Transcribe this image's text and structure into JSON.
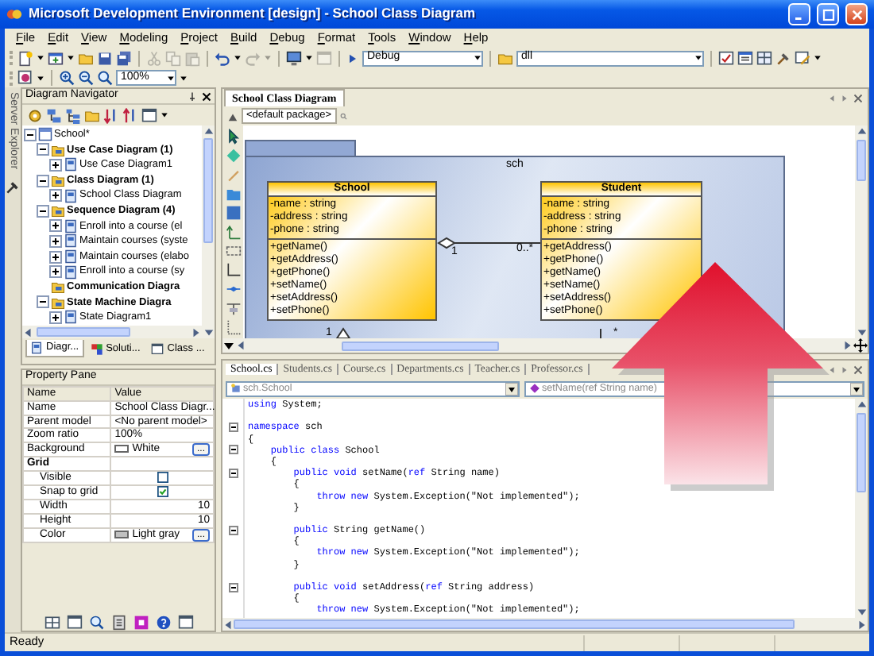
{
  "window": {
    "title": "Microsoft Development Environment [design] - School Class Diagram"
  },
  "menu": [
    "File",
    "Edit",
    "View",
    "Modeling",
    "Project",
    "Build",
    "Debug",
    "Format",
    "Tools",
    "Window",
    "Help"
  ],
  "toolbar": {
    "groups": [
      [
        {
          "kind": "new-project",
          "disabled": false,
          "has_menu": true
        },
        {
          "kind": "add-item",
          "disabled": false,
          "has_menu": true
        },
        {
          "kind": "open",
          "disabled": false,
          "has_menu": false
        },
        {
          "kind": "save",
          "disabled": false,
          "has_menu": false
        },
        {
          "kind": "save-all",
          "disabled": false,
          "has_menu": false
        }
      ],
      [
        {
          "kind": "cut",
          "disabled": true,
          "has_menu": false
        },
        {
          "kind": "copy",
          "disabled": true,
          "has_menu": false
        },
        {
          "kind": "paste",
          "disabled": true,
          "has_menu": false
        }
      ],
      [
        {
          "kind": "undo",
          "disabled": false,
          "has_menu": true
        },
        {
          "kind": "redo",
          "disabled": true,
          "has_menu": true
        }
      ],
      [
        {
          "kind": "navigate",
          "disabled": false,
          "has_menu": true
        },
        {
          "kind": "browse",
          "disabled": true,
          "has_menu": false
        }
      ]
    ],
    "configuration": "Debug",
    "project": "dll",
    "zoom": "100%"
  },
  "side_strip": {
    "label": "Server Explorer"
  },
  "diagram_navigator": {
    "title": "Diagram Navigator",
    "tree": [
      {
        "label": "School*",
        "kind": "model",
        "expanded": true,
        "children": [
          {
            "label": "Use Case Diagram (1)",
            "kind": "folder",
            "expanded": true,
            "children": [
              {
                "label": "Use Case Diagram1",
                "kind": "diagram",
                "expanded": false
              }
            ]
          },
          {
            "label": "Class Diagram (1)",
            "kind": "folder",
            "expanded": true,
            "children": [
              {
                "label": "School Class Diagram",
                "kind": "diagram",
                "expanded": false
              }
            ]
          },
          {
            "label": "Sequence Diagram (4)",
            "kind": "folder",
            "expanded": true,
            "children": [
              {
                "label": "Enroll into a course (el",
                "kind": "diagram",
                "expanded": false
              },
              {
                "label": "Maintain courses (syste",
                "kind": "diagram",
                "expanded": false
              },
              {
                "label": "Maintain courses (elabo",
                "kind": "diagram",
                "expanded": false
              },
              {
                "label": "Enroll into a course (sy",
                "kind": "diagram",
                "expanded": false
              }
            ]
          },
          {
            "label": "Communication Diagra",
            "kind": "folder"
          },
          {
            "label": "State Machine Diagra",
            "kind": "folder",
            "expanded": true,
            "children": [
              {
                "label": "State Diagram1",
                "kind": "diagram",
                "expanded": false
              }
            ]
          }
        ]
      }
    ],
    "tabs": [
      {
        "label": "Diagr...",
        "selected": true
      },
      {
        "label": "Soluti...",
        "selected": false
      },
      {
        "label": "Class ...",
        "selected": false
      }
    ]
  },
  "property_pane": {
    "title": "Property Pane",
    "columns": [
      "Name",
      "Value"
    ],
    "rows": [
      {
        "kind": "text",
        "name": "Name",
        "value": "School Class Diagr..."
      },
      {
        "kind": "text",
        "name": "Parent model",
        "value": "<No parent model>"
      },
      {
        "kind": "text",
        "name": "Zoom ratio",
        "value": "100%"
      },
      {
        "kind": "color",
        "name": "Background",
        "value": "White",
        "color": "#ffffff",
        "button": "..."
      },
      {
        "kind": "group",
        "name": "Grid",
        "children": [
          {
            "kind": "check",
            "name": "Visible",
            "checked": false
          },
          {
            "kind": "check",
            "name": "Snap to grid",
            "checked": true
          },
          {
            "kind": "number",
            "name": "Width",
            "value": "10"
          },
          {
            "kind": "number",
            "name": "Height",
            "value": "10"
          },
          {
            "kind": "color",
            "name": "Color",
            "value": "Light gray",
            "color": "#c0c0c0",
            "button": "..."
          }
        ]
      }
    ]
  },
  "diagram": {
    "tab": {
      "label": "School Class Diagram",
      "selected": true
    },
    "breadcrumb": "<default package>",
    "package": "sch",
    "classes": [
      {
        "name": "School",
        "attributes": [
          "-name : string",
          "-address : string",
          "-phone : string"
        ],
        "methods": [
          "+getName()",
          "+getAddress()",
          "+getPhone()",
          "+setName()",
          "+setAddress()",
          "+setPhone()"
        ],
        "lower_label": "1"
      },
      {
        "name": "Student",
        "attributes": [
          "-name : string",
          "-address : string",
          "-phone : string"
        ],
        "methods": [
          "+getAddress()",
          "+getPhone()",
          "+getName()",
          "+setName()",
          "+setAddress()",
          "+setPhone()"
        ],
        "lower_label": "*"
      }
    ],
    "association": {
      "source_multiplicity": "1",
      "target_multiplicity": "0..*"
    }
  },
  "code_editor": {
    "tabs": [
      {
        "label": "School.cs",
        "selected": true
      },
      {
        "label": "Students.cs",
        "selected": false
      },
      {
        "label": "Course.cs",
        "selected": false
      },
      {
        "label": "Departments.cs",
        "selected": false
      },
      {
        "label": "Teacher.cs",
        "selected": false
      },
      {
        "label": "Professor.cs",
        "selected": false
      }
    ],
    "type_selector": "sch.School",
    "member_selector": "setName(ref String name)",
    "lines": [
      {
        "fold": false,
        "gap_before": false,
        "tokens": [
          {
            "kind": "keyword",
            "text": "using"
          },
          {
            "kind": "plain",
            "text": " System;"
          }
        ]
      },
      {
        "fold": true,
        "gap_before": true,
        "tokens": [
          {
            "kind": "keyword",
            "text": "namespace"
          },
          {
            "kind": "plain",
            "text": " sch"
          }
        ]
      },
      {
        "fold": false,
        "gap_before": false,
        "tokens": [
          {
            "kind": "plain",
            "text": "{"
          }
        ]
      },
      {
        "fold": true,
        "gap_before": false,
        "tokens": [
          {
            "kind": "keyword",
            "text": "    public class"
          },
          {
            "kind": "plain",
            "text": " School"
          }
        ]
      },
      {
        "fold": false,
        "gap_before": false,
        "tokens": [
          {
            "kind": "plain",
            "text": "    {"
          }
        ]
      },
      {
        "fold": true,
        "gap_before": false,
        "tokens": [
          {
            "kind": "keyword",
            "text": "        public void"
          },
          {
            "kind": "plain",
            "text": " setName("
          },
          {
            "kind": "keyword",
            "text": "ref"
          },
          {
            "kind": "plain",
            "text": " String name)"
          }
        ]
      },
      {
        "fold": false,
        "gap_before": false,
        "tokens": [
          {
            "kind": "plain",
            "text": "        {"
          }
        ]
      },
      {
        "fold": false,
        "gap_before": false,
        "tokens": [
          {
            "kind": "keyword",
            "text": "            throw new"
          },
          {
            "kind": "plain",
            "text": " System.Exception(\"Not implemented\");"
          }
        ]
      },
      {
        "fold": false,
        "gap_before": false,
        "tokens": [
          {
            "kind": "plain",
            "text": "        }"
          }
        ]
      },
      {
        "fold": true,
        "gap_before": true,
        "tokens": [
          {
            "kind": "keyword",
            "text": "        public"
          },
          {
            "kind": "plain",
            "text": " String getName()"
          }
        ]
      },
      {
        "fold": false,
        "gap_before": false,
        "tokens": [
          {
            "kind": "plain",
            "text": "        {"
          }
        ]
      },
      {
        "fold": false,
        "gap_before": false,
        "tokens": [
          {
            "kind": "keyword",
            "text": "            throw new"
          },
          {
            "kind": "plain",
            "text": " System.Exception(\"Not implemented\");"
          }
        ]
      },
      {
        "fold": false,
        "gap_before": false,
        "tokens": [
          {
            "kind": "plain",
            "text": "        }"
          }
        ]
      },
      {
        "fold": true,
        "gap_before": true,
        "tokens": [
          {
            "kind": "keyword",
            "text": "        public void"
          },
          {
            "kind": "plain",
            "text": " setAddress("
          },
          {
            "kind": "keyword",
            "text": "ref"
          },
          {
            "kind": "plain",
            "text": " String address)"
          }
        ]
      },
      {
        "fold": false,
        "gap_before": false,
        "tokens": [
          {
            "kind": "plain",
            "text": "        {"
          }
        ]
      },
      {
        "fold": false,
        "gap_before": false,
        "tokens": [
          {
            "kind": "keyword",
            "text": "            throw new"
          },
          {
            "kind": "plain",
            "text": " System.Exception(\"Not implemented\");"
          }
        ]
      }
    ]
  },
  "status_bar": {
    "text": "Ready"
  }
}
